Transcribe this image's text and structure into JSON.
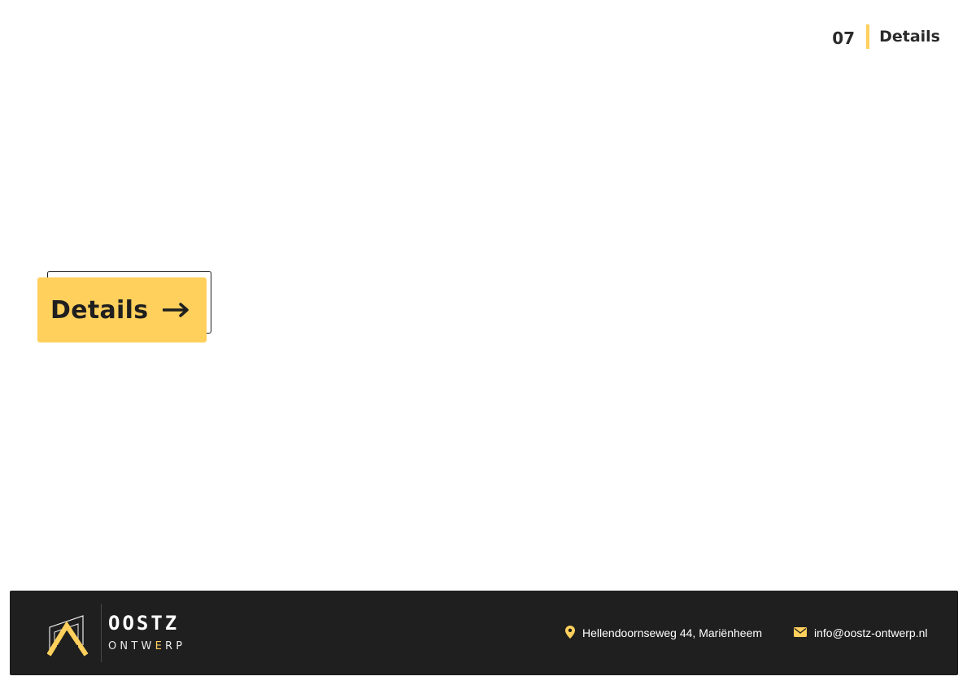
{
  "header": {
    "page_number": "07",
    "page_label": "Details"
  },
  "main": {
    "details_button_label": "Details",
    "details_button_icon": "arrow-right-icon"
  },
  "footer": {
    "logo": {
      "title": "OOSTZ",
      "subtitle_part1": "ONTW",
      "subtitle_accent": "E",
      "subtitle_part2": "RP"
    },
    "address": "Hellendoornseweg 44, Mariënheem",
    "address_icon": "map-pin-icon",
    "email": "info@oostz-ontwerp.nl",
    "email_icon": "mail-icon"
  },
  "colors": {
    "accent": "#ffd05c",
    "dark": "#1f1f1f",
    "text_dark": "#2a2a2a"
  }
}
